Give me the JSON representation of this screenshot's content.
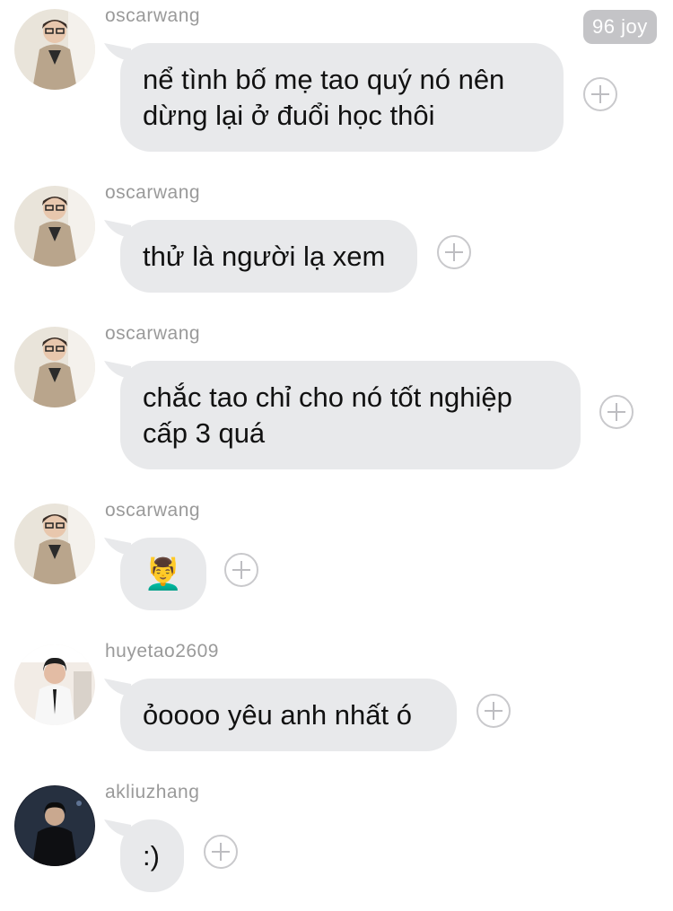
{
  "badge": "96 joy",
  "messages": [
    {
      "user": "oscarwang",
      "text_lines": [
        "nể tình bố mẹ tao quý nó nên",
        "dừng lại ở đuổi học thôi"
      ]
    },
    {
      "user": "oscarwang",
      "text": "thử là người lạ xem"
    },
    {
      "user": "oscarwang",
      "text_lines": [
        "chắc tao chỉ cho nó tốt nghiệp",
        "cấp 3 quá"
      ]
    },
    {
      "user": "oscarwang",
      "text": "💆‍♂️"
    },
    {
      "user": "huyetao2609",
      "text": "ỏoooo yêu anh nhất ó"
    },
    {
      "user": "akliuzhang",
      "text": ":)"
    }
  ],
  "icons": {
    "react": "add-reaction-icon",
    "avatar": "user-avatar"
  },
  "colors": {
    "bubble": "#e8e9eb",
    "username": "#9a9a9a",
    "badge": "#c4c4c7"
  }
}
